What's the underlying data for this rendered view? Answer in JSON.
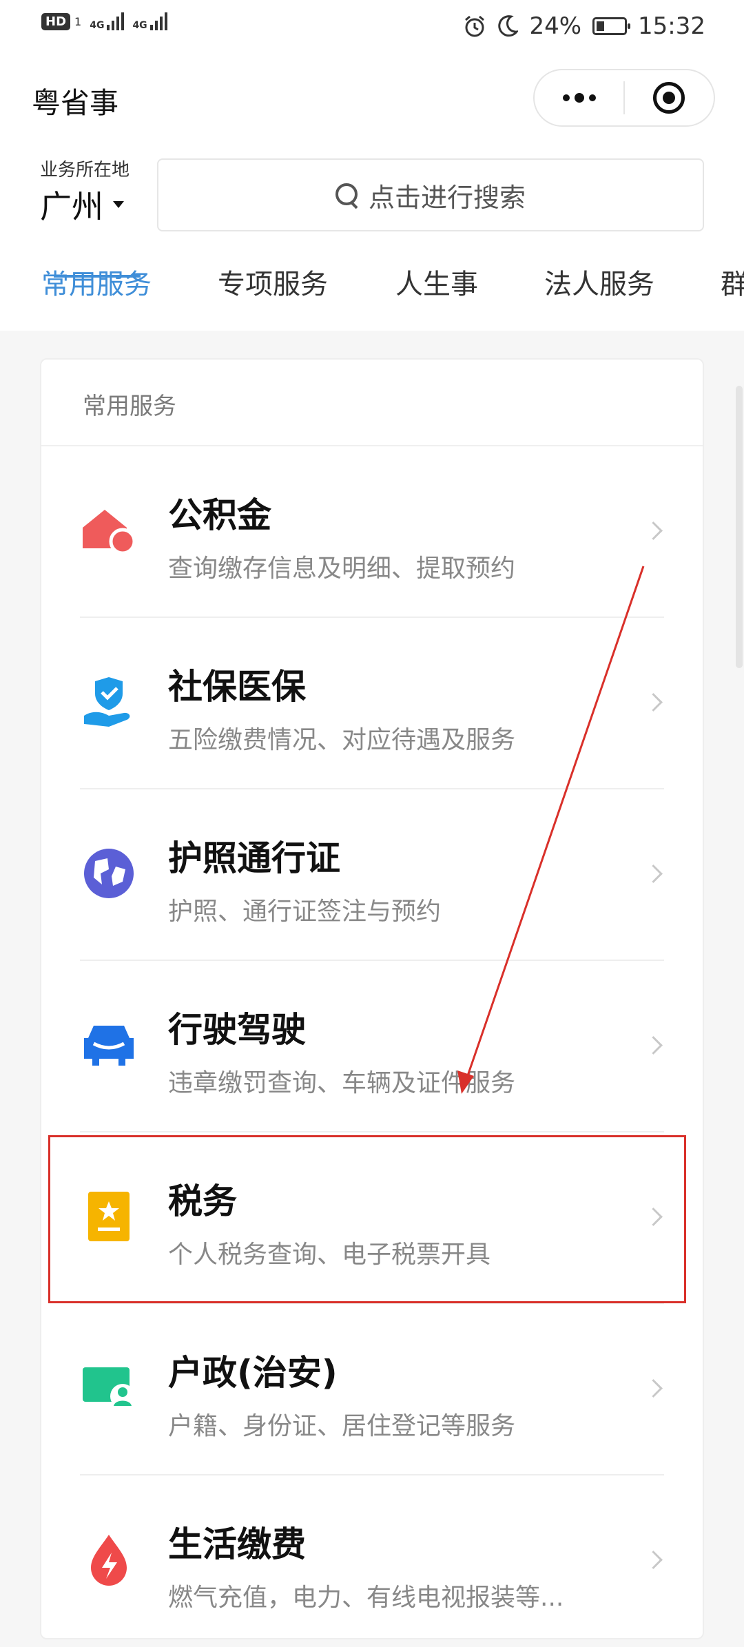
{
  "status_bar": {
    "hd": "HD",
    "hd_sub": "1",
    "net1": "4G",
    "net2": "4G",
    "battery": "24%",
    "time": "15:32"
  },
  "header": {
    "app_title": "粤省事",
    "location_label": "业务所在地",
    "city": "广州",
    "search_placeholder": "点击进行搜索"
  },
  "tabs": [
    {
      "label": "常用服务",
      "active": true
    },
    {
      "label": "专项服务",
      "active": false
    },
    {
      "label": "人生事",
      "active": false
    },
    {
      "label": "法人服务",
      "active": false
    },
    {
      "label": "群",
      "active": false
    }
  ],
  "card": {
    "title": "常用服务",
    "items": [
      {
        "title": "公积金",
        "desc": "查询缴存信息及明细、提取预约",
        "icon": "house-icon"
      },
      {
        "title": "社保医保",
        "desc": "五险缴费情况、对应待遇及服务",
        "icon": "shield-hand-icon"
      },
      {
        "title": "护照通行证",
        "desc": "护照、通行证签注与预约",
        "icon": "globe-icon"
      },
      {
        "title": "行驶驾驶",
        "desc": "违章缴罚查询、车辆及证件服务",
        "icon": "car-icon"
      },
      {
        "title": "税务",
        "desc": "个人税务查询、电子税票开具",
        "icon": "tax-icon"
      },
      {
        "title": "户政(治安)",
        "desc": "户籍、身份证、居住登记等服务",
        "icon": "id-card-icon"
      },
      {
        "title": "生活缴费",
        "desc": "燃气充值，电力、有线电视报装等...",
        "icon": "utility-drop-icon"
      }
    ]
  },
  "colors": {
    "accent": "#3f8ed8",
    "annotation": "#d9302a",
    "house": "#ef5b5b",
    "shield": "#1f9be8",
    "globe": "#5b5fd6",
    "car": "#1f72e6",
    "tax": "#f6b400",
    "id_card": "#21c48d",
    "drop": "#ef4a4a"
  }
}
